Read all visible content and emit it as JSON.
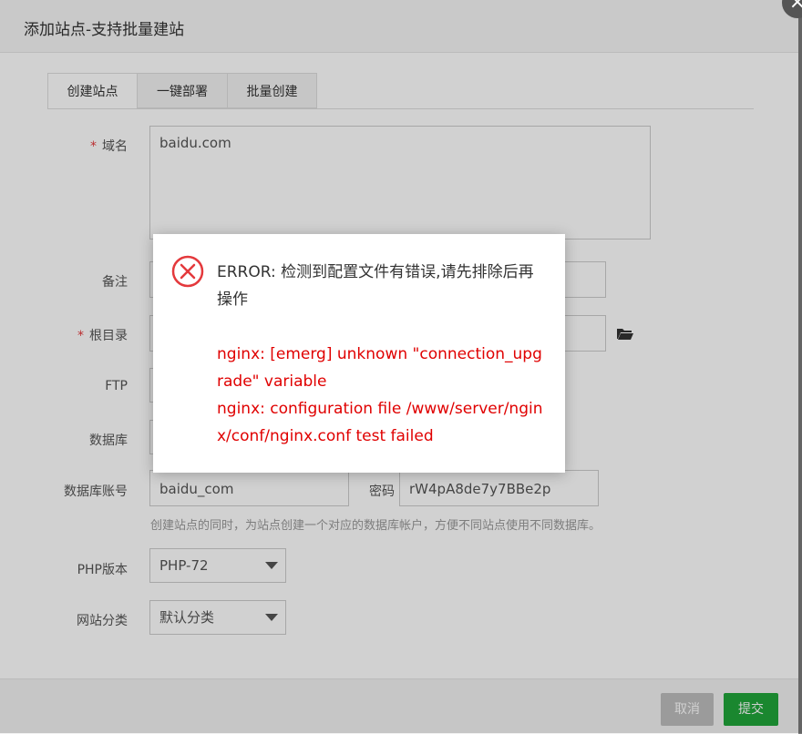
{
  "window": {
    "title": "添加站点-支持批量建站",
    "close_symbol": "×"
  },
  "tabs": [
    {
      "label": "创建站点",
      "active": true
    },
    {
      "label": "一键部署",
      "active": false
    },
    {
      "label": "批量创建",
      "active": false
    }
  ],
  "form": {
    "required_mark": "*",
    "domain": {
      "label": "域名",
      "value": "baidu.com"
    },
    "remark": {
      "label": "备注",
      "value": ""
    },
    "root": {
      "label": "根目录",
      "value": ""
    },
    "ftp": {
      "label": "FTP"
    },
    "database": {
      "label": "数据库"
    },
    "db_account": {
      "label": "数据库账号",
      "value": "baidu_com"
    },
    "password": {
      "label": "密码",
      "value": "rW4pA8de7y7BBe2p"
    },
    "db_hint": "创建站点的同时，为站点创建一个对应的数据库帐户，方便不同站点使用不同数据库。",
    "php": {
      "label": "PHP版本",
      "value": "PHP-72"
    },
    "category": {
      "label": "网站分类",
      "value": "默认分类"
    }
  },
  "footer": {
    "cancel_label": "取消",
    "submit_label": "提交"
  },
  "error_dialog": {
    "line1": "ERROR: 检测到配置文件有错误,请先排除后再操作",
    "line2": "nginx: [emerg] unknown \"connection_upgrade\" variable",
    "line3": "nginx: configuration file /www/server/nginx/conf/nginx.conf test failed"
  },
  "colors": {
    "accent_green": "#20a53a",
    "error_red": "#e00000",
    "disabled_gray": "#bdbdbd"
  }
}
